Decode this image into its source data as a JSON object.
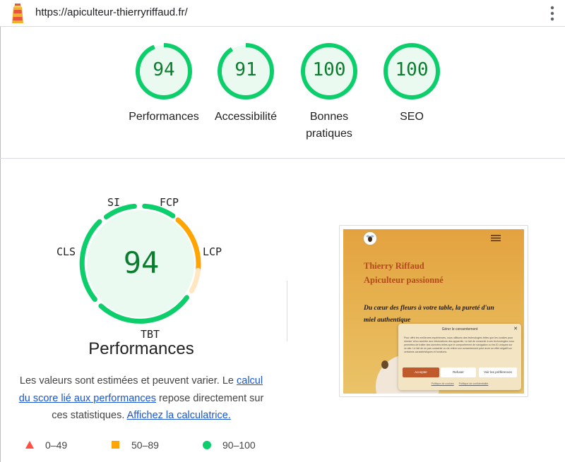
{
  "header": {
    "url": "https://apiculteur-thierryriffaud.fr/",
    "logo_icon": "lighthouse-icon",
    "menu_icon": "kebab-menu-icon"
  },
  "colors": {
    "pass": "#0cce6b",
    "pass_text": "#0c7c2e",
    "average": "#ffa400",
    "fail": "#ff4e42",
    "pass_bg": "#eafaf1",
    "link": "#1a55d6"
  },
  "categories": [
    {
      "score": "94",
      "value": 94,
      "label": "Performances"
    },
    {
      "score": "91",
      "value": 91,
      "label": "Accessibilité"
    },
    {
      "score": "100",
      "value": 100,
      "label": "Bonnes pratiques"
    },
    {
      "score": "100",
      "value": 100,
      "label": "SEO"
    }
  ],
  "performance": {
    "score": "94",
    "title": "Performances",
    "metrics": {
      "si": "SI",
      "fcp": "FCP",
      "lcp": "LCP",
      "tbt": "TBT",
      "cls": "CLS"
    },
    "desc_before": "Les valeurs sont estimées et peuvent varier. Le ",
    "desc_link1": "calcul du score lié aux performances",
    "desc_middle": " repose directement sur ces statistiques. ",
    "desc_link2": "Affichez la calculatrice."
  },
  "legend": [
    {
      "range": "0–49",
      "icon": "triangle-icon"
    },
    {
      "range": "50–89",
      "icon": "square-icon"
    },
    {
      "range": "90–100",
      "icon": "circle-icon"
    }
  ],
  "screenshot": {
    "site_title_line1": "Thierry Riffaud",
    "site_title_line2": "Apiculteur passionné",
    "tagline": "Du cœur des fleurs à votre table, la pureté d'un miel authentique",
    "consent_title": "Gérer le consentement",
    "consent_close": "✕",
    "consent_text": "Pour offrir les meilleures expériences, nous utilisons des technologies telles que les cookies pour stocker et/ou accéder aux informations des appareils. Le fait de consentir à ces technologies nous permettra de traiter des données telles que le comportement de navigation ou les ID uniques sur ce site. Le fait de ne pas consentir ou de retirer son consentement peut avoir un effet négatif sur certaines caractéristiques et fonctions.",
    "accept_label": "Accepter",
    "refuse_label": "Refuser",
    "prefs_label": "Voir les préférences",
    "link_cookies": "Politique de cookies",
    "link_privacy": "Politique de confidentialité"
  }
}
